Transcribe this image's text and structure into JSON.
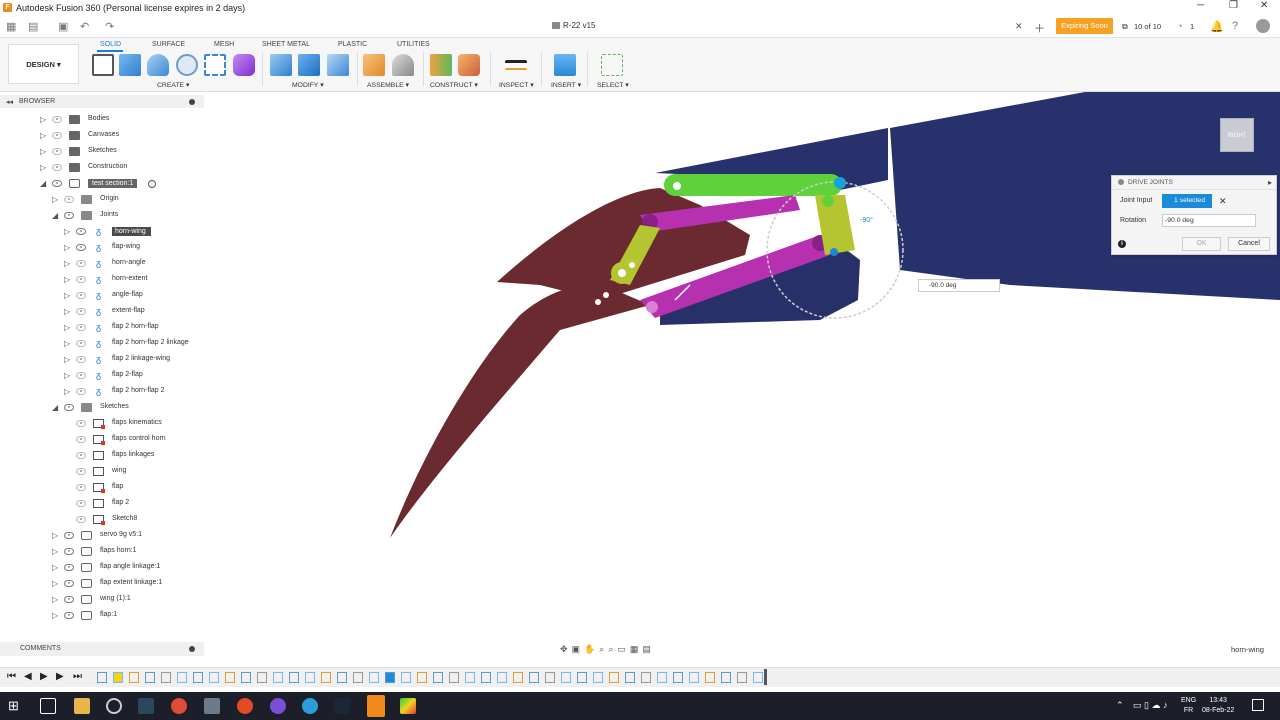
{
  "window": {
    "title": "Autodesk Fusion 360 (Personal license expires in 2 days)"
  },
  "document": {
    "tab_title": "R-22 v15",
    "expiring_label": "Expiring Soon",
    "version_count": "10 of 10",
    "notif_count": "1"
  },
  "workspace": {
    "design_label": "DESIGN ▾",
    "tabs": [
      "SOLID",
      "SURFACE",
      "MESH",
      "SHEET METAL",
      "PLASTIC",
      "UTILITIES"
    ],
    "groups": [
      "CREATE ▾",
      "MODIFY ▾",
      "ASSEMBLE ▾",
      "CONSTRUCT ▾",
      "INSPECT ▾",
      "INSERT ▾",
      "SELECT ▾"
    ]
  },
  "browser": {
    "title": "BROWSER",
    "rows": [
      {
        "label": "Bodies",
        "icon": "folder-icon"
      },
      {
        "label": "Canvases",
        "icon": "folder-icon"
      },
      {
        "label": "Sketches",
        "icon": "folder-icon"
      },
      {
        "label": "Construction",
        "icon": "folder-icon"
      },
      {
        "label": "test section:1",
        "icon": "component-icon"
      },
      {
        "label": "Origin",
        "icon": "folder-icon"
      },
      {
        "label": "Joints",
        "icon": "folder-icon"
      },
      {
        "label": "horn-wing",
        "icon": "joint-icon"
      },
      {
        "label": "flap-wing",
        "icon": "joint-icon"
      },
      {
        "label": "horn-angle",
        "icon": "joint-icon"
      },
      {
        "label": "horn-extent",
        "icon": "joint-icon"
      },
      {
        "label": "angle-flap",
        "icon": "joint-icon"
      },
      {
        "label": "extent-flap",
        "icon": "joint-icon"
      },
      {
        "label": "flap 2 horn-flap",
        "icon": "joint-icon"
      },
      {
        "label": "flap 2 horn-flap 2 linkage",
        "icon": "joint-icon"
      },
      {
        "label": "flap 2 linkage-wing",
        "icon": "joint-icon"
      },
      {
        "label": "flap 2-flap",
        "icon": "joint-icon"
      },
      {
        "label": "flap 2 horn-flap 2",
        "icon": "joint-icon"
      },
      {
        "label": "Sketches",
        "icon": "folder-icon"
      },
      {
        "label": "flaps kinematics",
        "icon": "sketch-icon"
      },
      {
        "label": "flaps control horn",
        "icon": "sketch-icon"
      },
      {
        "label": "flaps linkages",
        "icon": "sketch-icon"
      },
      {
        "label": "wing",
        "icon": "sketch-icon"
      },
      {
        "label": "flap",
        "icon": "sketch-icon"
      },
      {
        "label": "flap 2",
        "icon": "sketch-icon"
      },
      {
        "label": "Sketch8",
        "icon": "sketch-icon"
      },
      {
        "label": "servo 9g v5:1",
        "icon": "component-icon"
      },
      {
        "label": "flaps horn:1",
        "icon": "component-icon"
      },
      {
        "label": "flap angle linkage:1",
        "icon": "component-icon"
      },
      {
        "label": "flap extent linkage:1",
        "icon": "component-icon"
      },
      {
        "label": "wing (1):1",
        "icon": "component-icon"
      },
      {
        "label": "flap:1",
        "icon": "component-icon"
      }
    ]
  },
  "comments": {
    "title": "COMMENTS"
  },
  "drive_joints": {
    "title": "DRIVE JOINTS",
    "joint_input_label": "Joint Input",
    "selected_label": "1 selected",
    "rotation_label": "Rotation",
    "rotation_value": "-90.0 deg",
    "ok_label": "OK",
    "cancel_label": "Cancel"
  },
  "viewport": {
    "value_box": "-90.0 deg",
    "angle_tag": "-90°",
    "viewcube_face": "RIGHT"
  },
  "status": {
    "selection_name": "horn-wing"
  },
  "taskbar": {
    "lang_top": "ENG",
    "lang_bottom": "FR",
    "time": "13:43",
    "date": "08-Feb-22"
  },
  "colors": {
    "accent": "#1a7fd6",
    "wing": "#27316b",
    "flap": "#6b2a30",
    "linkage_green": "#5fd13a",
    "linkage_magenta": "#b730b0",
    "horn_olive": "#b5c531",
    "expiring": "#f7a123"
  }
}
